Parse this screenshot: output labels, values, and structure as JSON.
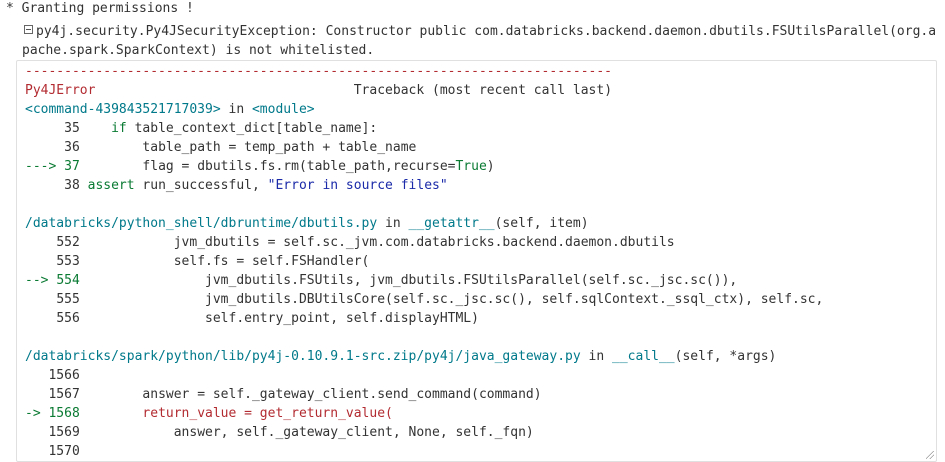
{
  "header": {
    "granting": "* Granting permissions !"
  },
  "exception": {
    "message": "py4j.security.Py4JSecurityException: Constructor public com.databricks.backend.daemon.dbutils.FSUtilsParallel(org.apache.spark.SparkContext) is not whitelisted."
  },
  "traceback": {
    "separator": "---------------------------------------------------------------------------",
    "error_name": "Py4JError",
    "header_right": "Traceback (most recent call last)",
    "frames": [
      {
        "location": "<command-439843521717039>",
        "in_word": " in ",
        "func": "<module>",
        "args": "",
        "lines": [
          {
            "arrow": "     ",
            "num": "35",
            "code": "    if table_context_dict[table_name]:"
          },
          {
            "arrow": "     ",
            "num": "36",
            "code": "        table_path = temp_path + table_name"
          },
          {
            "arrow": "---> ",
            "num": "37",
            "code": "        flag = dbutils.fs.rm(table_path,recurse=True)"
          },
          {
            "arrow": "     ",
            "num": "38",
            "code": " assert run_successful, \"Error in source files\""
          }
        ]
      },
      {
        "location": "/databricks/python_shell/dbruntime/dbutils.py",
        "in_word": " in ",
        "func": "__getattr__",
        "args": "(self, item)",
        "lines": [
          {
            "arrow": "    ",
            "num": "552",
            "code": "            jvm_dbutils = self.sc._jvm.com.databricks.backend.daemon.dbutils"
          },
          {
            "arrow": "    ",
            "num": "553",
            "code": "            self.fs = self.FSHandler("
          },
          {
            "arrow": "--> ",
            "num": "554",
            "code": "                jvm_dbutils.FSUtils, jvm_dbutils.FSUtilsParallel(self.sc._jsc.sc()),"
          },
          {
            "arrow": "    ",
            "num": "555",
            "code": "                jvm_dbutils.DBUtilsCore(self.sc._jsc.sc(), self.sqlContext._ssql_ctx), self.sc,"
          },
          {
            "arrow": "    ",
            "num": "556",
            "code": "                self.entry_point, self.displayHTML)"
          }
        ]
      },
      {
        "location": "/databricks/spark/python/lib/py4j-0.10.9.1-src.zip/py4j/java_gateway.py",
        "in_word": " in ",
        "func": "__call__",
        "args": "(self, *args)",
        "lines": [
          {
            "arrow": "   ",
            "num": "1566",
            "code": ""
          },
          {
            "arrow": "   ",
            "num": "1567",
            "code": "        answer = self._gateway_client.send_command(command)"
          },
          {
            "arrow": "-> ",
            "num": "1568",
            "code": "        return_value = get_return_value("
          },
          {
            "arrow": "   ",
            "num": "1569",
            "code": "            answer, self._gateway_client, None, self._fqn)"
          },
          {
            "arrow": "   ",
            "num": "1570",
            "code": ""
          }
        ]
      }
    ]
  },
  "colors": {
    "error_red": "#b22b31",
    "location_teal": "#00798a",
    "arrow_green": "#0a7a33",
    "string_blue": "#1a2aa8"
  }
}
